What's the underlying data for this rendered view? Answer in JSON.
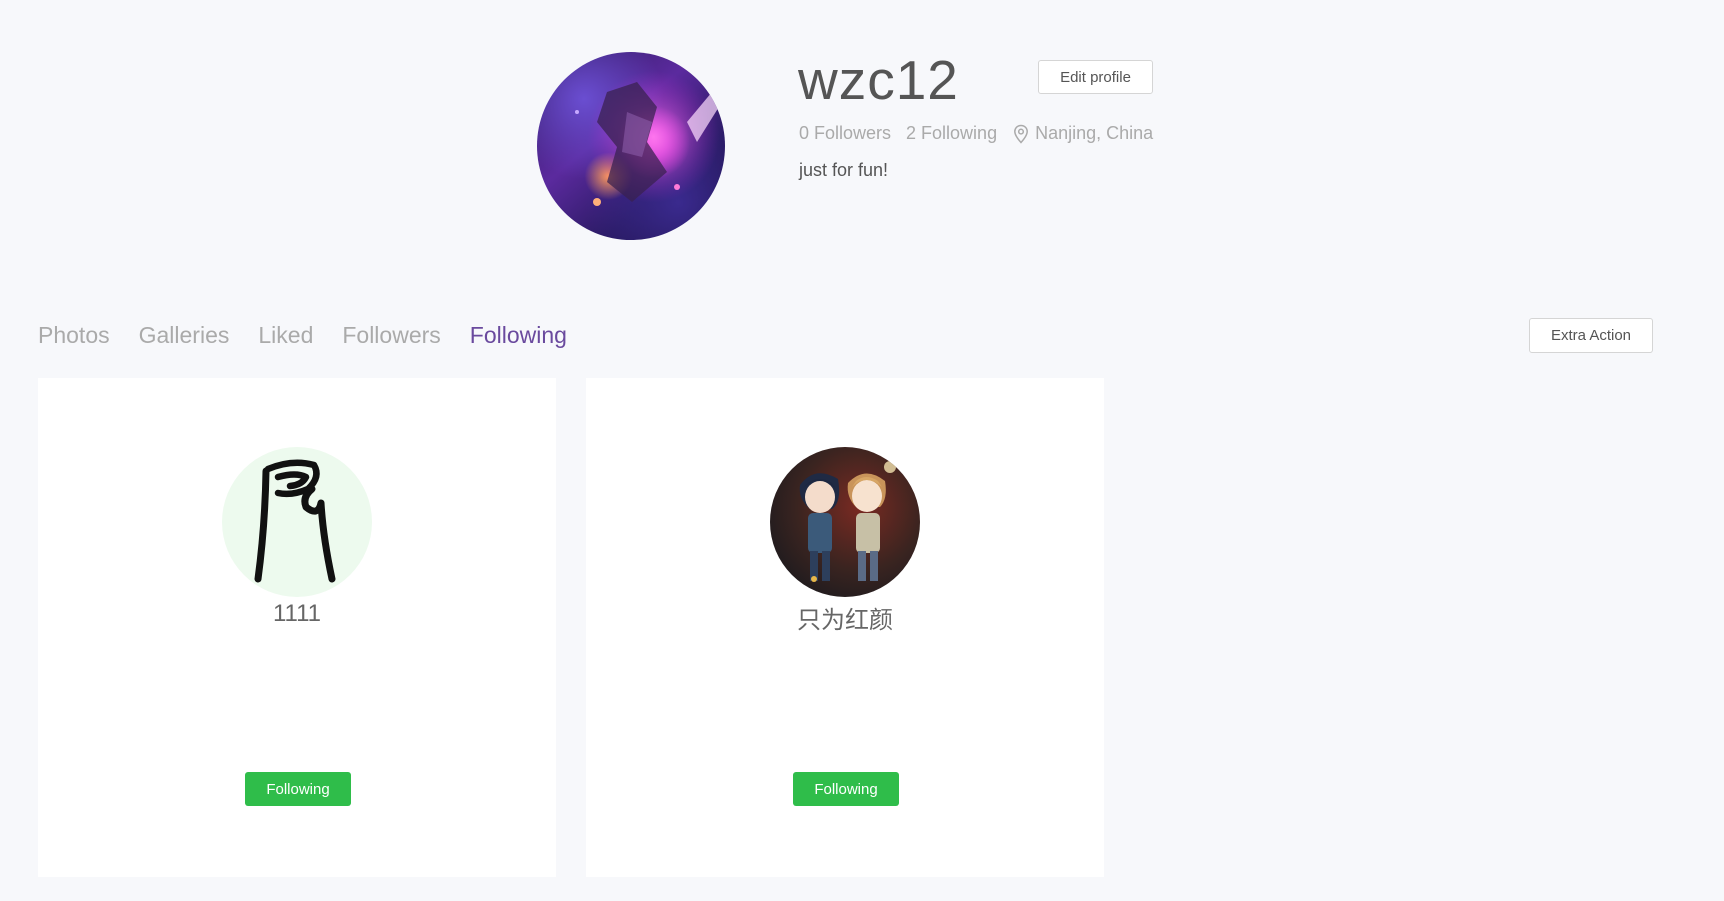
{
  "profile": {
    "username": "wzc12",
    "edit_label": "Edit profile",
    "followers_text": "0 Followers",
    "following_text": "2 Following",
    "location": "Nanjing, China",
    "bio": "just for fun!"
  },
  "tabs": [
    {
      "label": "Photos"
    },
    {
      "label": "Galleries"
    },
    {
      "label": "Liked"
    },
    {
      "label": "Followers"
    },
    {
      "label": "Following",
      "active": true
    }
  ],
  "extra_action_label": "Extra Action",
  "following_list": [
    {
      "name": "1111",
      "button_label": "Following"
    },
    {
      "name": "只为红颜",
      "button_label": "Following"
    }
  ],
  "colors": {
    "active_tab": "#6a4a9e",
    "following_button": "#2fbd4a",
    "background": "#f7f8fb"
  }
}
